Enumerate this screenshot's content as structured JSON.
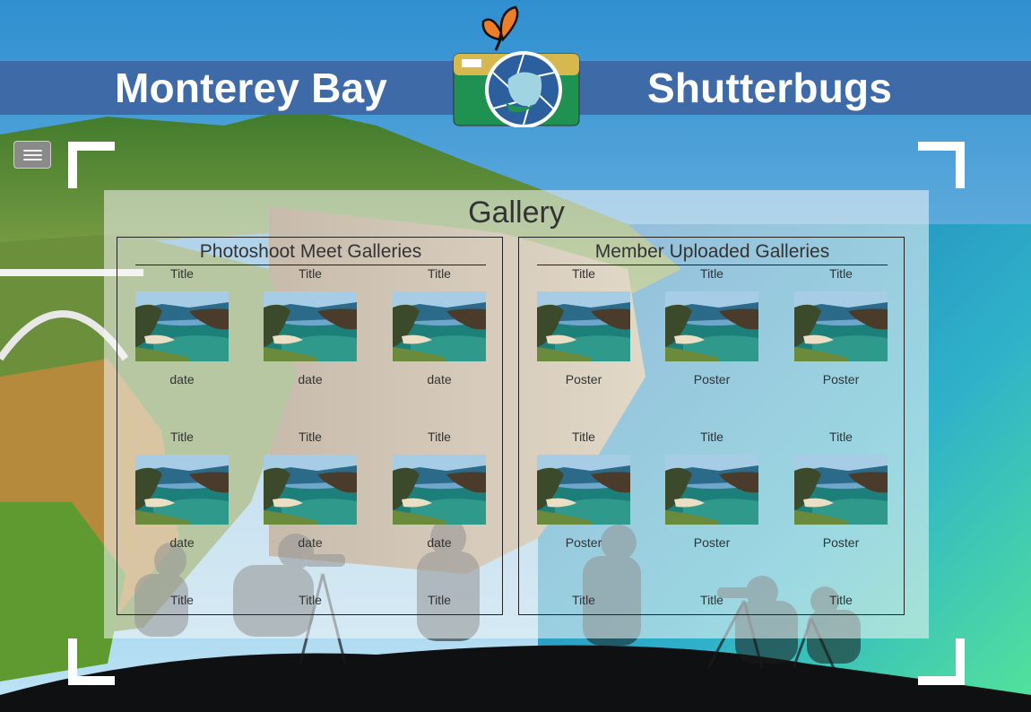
{
  "header": {
    "title_left": "Monterey Bay",
    "title_right": "Shutterbugs",
    "logo_icon": "camera-butterfly-logo-icon",
    "band_color": "#3f6aa8"
  },
  "menu": {
    "icon": "hamburger-menu-icon"
  },
  "gallery": {
    "title": "Gallery",
    "sections": [
      {
        "heading": "Photoshoot Meet Galleries",
        "items": [
          {
            "title": "Title",
            "caption": "date"
          },
          {
            "title": "Title",
            "caption": "date"
          },
          {
            "title": "Title",
            "caption": "date"
          },
          {
            "title": "Title",
            "caption": "date"
          },
          {
            "title": "Title",
            "caption": "date"
          },
          {
            "title": "Title",
            "caption": "date"
          },
          {
            "title": "Title",
            "caption": ""
          },
          {
            "title": "Title",
            "caption": ""
          },
          {
            "title": "Title",
            "caption": ""
          }
        ]
      },
      {
        "heading": "Member Uploaded Galleries",
        "items": [
          {
            "title": "Title",
            "caption": "Poster"
          },
          {
            "title": "Title",
            "caption": "Poster"
          },
          {
            "title": "Title",
            "caption": "Poster"
          },
          {
            "title": "Title",
            "caption": "Poster"
          },
          {
            "title": "Title",
            "caption": "Poster"
          },
          {
            "title": "Title",
            "caption": "Poster"
          },
          {
            "title": "Title",
            "caption": ""
          },
          {
            "title": "Title",
            "caption": ""
          },
          {
            "title": "Title",
            "caption": ""
          }
        ]
      }
    ]
  }
}
